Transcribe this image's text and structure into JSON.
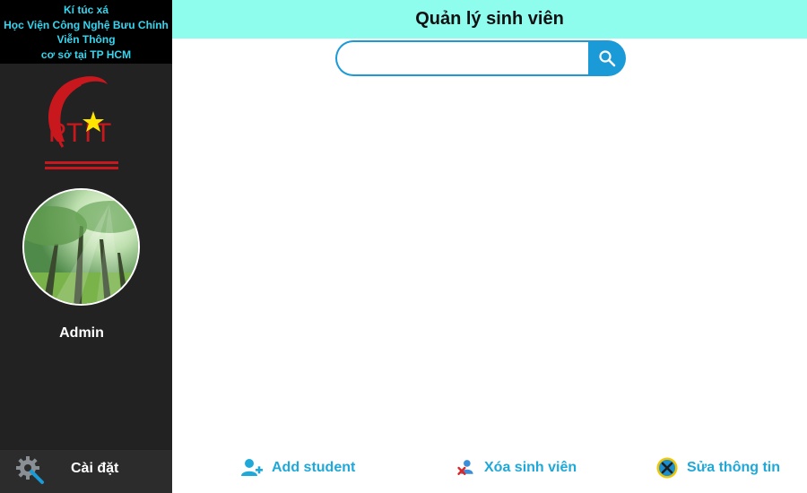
{
  "sidebar": {
    "org_lines": [
      "Kí túc xá",
      "Học Viện Công Nghệ Bưu Chính",
      "Viễn Thông",
      "cơ sở tại TP HCM"
    ],
    "logo_text": "PTIT",
    "user_name": "Admin",
    "settings_label": "Cài đặt"
  },
  "header": {
    "title": "Quản lý sinh viên"
  },
  "search": {
    "value": "",
    "placeholder": ""
  },
  "actions": {
    "add_label": "Add student",
    "delete_label": "Xóa sinh viên",
    "edit_label": "Sửa thông tin"
  },
  "colors": {
    "sidebar_bg": "#222222",
    "header_bg": "#8ffdee",
    "accent": "#1a9ad6",
    "org_text": "#35d6f0",
    "logo_red": "#c8181e",
    "logo_star": "#ffe600"
  }
}
